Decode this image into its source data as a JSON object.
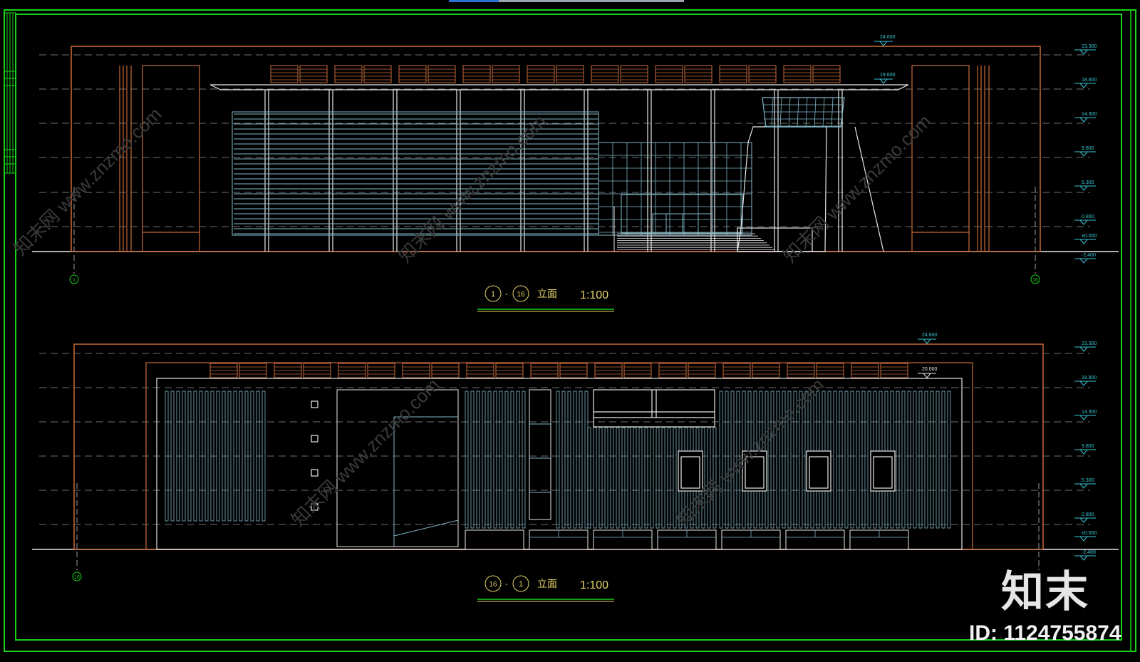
{
  "drawing": {
    "elevations": [
      {
        "id": "front",
        "title_from": "1",
        "title_to": "16",
        "title_text": "立面",
        "scale": "1:100",
        "left_axis": "1",
        "right_axis": "16",
        "levels_right": [
          "23.300",
          "18.600",
          "14.300",
          "9.800",
          "5.300",
          "0.800",
          "±0.000",
          "-2.400"
        ],
        "roof_level_label": "24.600",
        "canopy_level_label": "19.600"
      },
      {
        "id": "rear",
        "title_from": "16",
        "title_to": "1",
        "title_text": "立面",
        "scale": "1:100",
        "left_axis": "16",
        "levels_right": [
          "23.300",
          "18.800",
          "14.300",
          "9.800",
          "5.300",
          "0.800",
          "±0.000",
          "-2.400"
        ],
        "roof_level_label": "24.600",
        "parapet_level_label": "20.000"
      }
    ],
    "watermark": {
      "logo_text": "知末",
      "id_text": "ID: 1124755874",
      "site_text": "www.znzmo.com",
      "site_text_cn": "知末网"
    }
  },
  "colors": {
    "background": "#000000",
    "frame_green": "#19d219",
    "outline_orange": "#c86a3a",
    "glass_cyan": "#7fb7c9",
    "white_lines": "#e8e8e8",
    "level_cyan": "#39c6d6",
    "title_yellow": "#e6d36a"
  }
}
